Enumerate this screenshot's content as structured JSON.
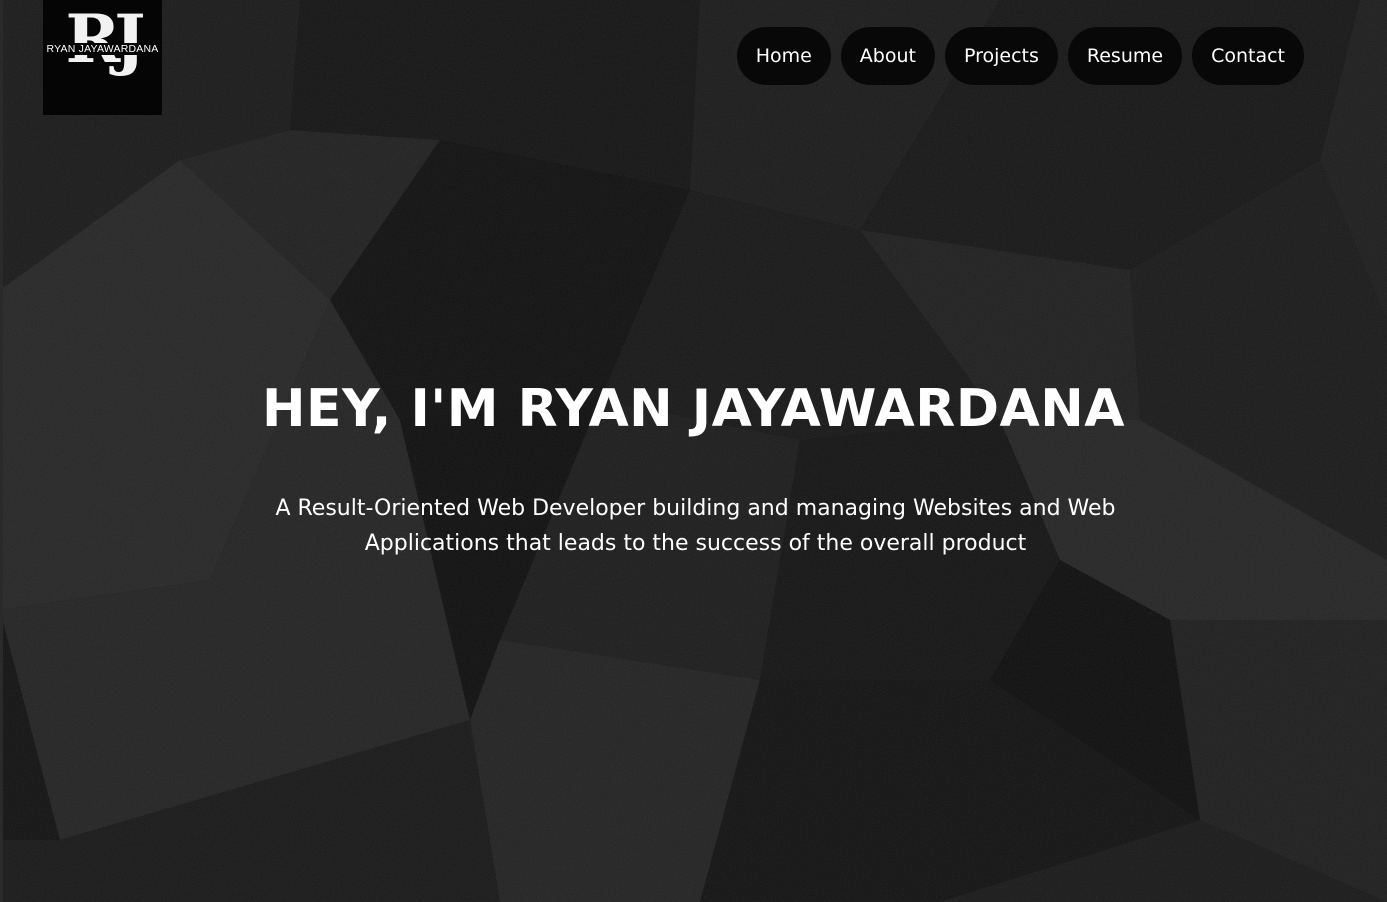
{
  "logo": {
    "monogram": "RJ",
    "name": "RYAN JAYAWARDANA"
  },
  "nav": {
    "items": [
      {
        "label": "Home"
      },
      {
        "label": "About"
      },
      {
        "label": "Projects"
      },
      {
        "label": "Resume"
      },
      {
        "label": "Contact"
      }
    ]
  },
  "hero": {
    "title": "HEY, I'M RYAN JAYAWARDANA",
    "subtitle": "A Result-Oriented Web Developer building and managing Websites and Web Applications that leads to the success of the overall product"
  },
  "colors": {
    "background": "#111111",
    "text": "#ffffff",
    "nav_button": "#080808"
  }
}
